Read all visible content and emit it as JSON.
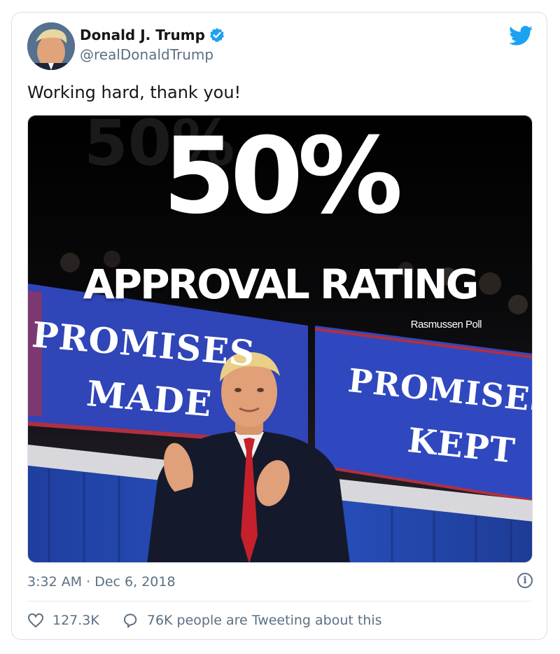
{
  "tweet": {
    "display_name": "Donald J. Trump",
    "handle": "@realDonaldTrump",
    "text": "Working hard, thank you!",
    "timestamp": "3:32 AM · Dec 6, 2018",
    "likes": "127.3K",
    "retweet_text": "76K people are Tweeting about this",
    "verified": true
  },
  "media": {
    "headline_number": "50%",
    "headline_text": "APPROVAL RATING",
    "source": "Rasmussen Poll",
    "sign_left_line1": "PROMISES",
    "sign_left_line2": "MADE",
    "sign_right_line1": "PROMISES",
    "sign_right_line2": "KEPT"
  },
  "icons": {
    "brand": "twitter-bird-icon",
    "verified": "verified-badge-icon",
    "like": "heart-icon",
    "reply": "speech-bubble-icon",
    "info": "info-icon"
  },
  "colors": {
    "twitter_blue": "#1da1f2",
    "text_secondary": "#5b7083",
    "sign_blue": "#2f45b8"
  }
}
